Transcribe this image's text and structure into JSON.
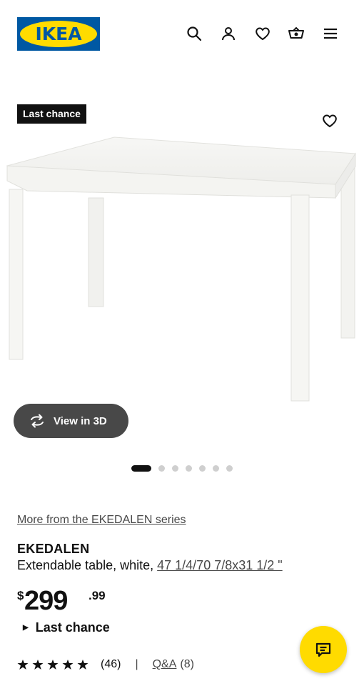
{
  "header": {
    "logo_text": "IKEA",
    "icons": [
      "search-icon",
      "account-icon",
      "favorites-icon",
      "cart-icon",
      "menu-icon"
    ]
  },
  "badge": {
    "label": "Last chance"
  },
  "gallery": {
    "view3d_label": "View in 3D",
    "total_images": 7,
    "active_index": 0
  },
  "product": {
    "series_link": "More from the EKEDALEN series",
    "name": "EKEDALEN",
    "description_prefix": "Extendable table, white, ",
    "dimensions": "47 1/4/70 7/8x31 1/2 \"",
    "price_currency": "$",
    "price_integer": "299",
    "price_decimal": ".99",
    "status": "Last chance",
    "rating_stars": 5,
    "review_count": "(46)",
    "separator": "|",
    "qa_label": "Q&A",
    "qa_count": "(8)"
  },
  "colors": {
    "brand_blue": "#0058a3",
    "brand_yellow": "#ffdb00",
    "dark": "#111111"
  }
}
